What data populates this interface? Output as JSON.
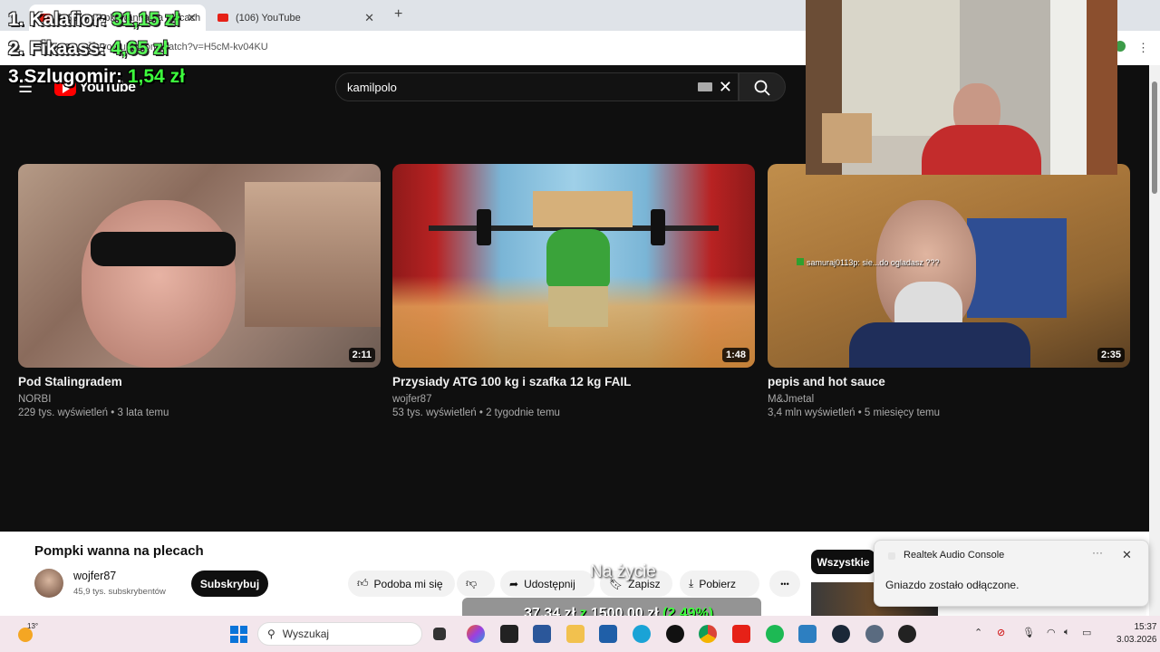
{
  "browser": {
    "tabs": [
      {
        "label": "(106) Pompki wanna na plecach",
        "active": true
      },
      {
        "label": "(106) YouTube",
        "active": false
      }
    ],
    "url": "youtube.com/watch?v=H5cM-kv04KU"
  },
  "youtube": {
    "search_query": "kamilpolo",
    "videos": [
      {
        "title": "Pod Stalingradem",
        "channel": "NORBI",
        "meta": "229 tys. wyświetleń • 3 lata temu",
        "duration": "2:11"
      },
      {
        "title": "Przysiady ATG 100 kg i szafka 12 kg FAIL",
        "channel": "wojfer87",
        "meta": "53 tys. wyświetleń • 2 tygodnie temu",
        "duration": "1:48"
      },
      {
        "title": "pepis and hot sauce",
        "channel": "M&Jmetal",
        "meta": "3,4 mln wyświetleń • 5 miesięcy temu",
        "duration": "2:35"
      }
    ],
    "chat_overlay": {
      "user": "samuraj0113p:",
      "message": "sie...do ogladasz ???"
    }
  },
  "watch": {
    "title": "Pompki wanna na plecach",
    "channel": "wojfer87",
    "subs": "45,9 tys. subskrybentów",
    "subscribe": "Subskrybuj",
    "like": "Podoba mi się",
    "share": "Udostępnij",
    "save": "Zapisz",
    "download": "Pobierz",
    "more": "•••",
    "all_chip": "Wszystkie"
  },
  "overlay": {
    "donors": [
      {
        "rank": "1. Kalafior:",
        "amount": "31,15 zł"
      },
      {
        "rank": "2. Fikaass:",
        "amount": "4,65 zł"
      },
      {
        "rank": "3.Szlugomir:",
        "amount": "1,54 zł"
      }
    ],
    "goal_label": "Na życie",
    "goal_current": "37,34 zł",
    "goal_sep": "z",
    "goal_target": "1500,00 zł",
    "goal_pct": "(2.49%)"
  },
  "toast": {
    "app": "Realtek Audio Console",
    "message": "Gniazdo zostało odłączone."
  },
  "taskbar": {
    "search_placeholder": "Wyszukaj",
    "temp": "13°",
    "time": "15:37",
    "date": "3.03.2026"
  },
  "colors": {
    "youtube_red": "#ff0000",
    "donation_green": "#3dff3d",
    "windows_blue": "#0a74d9"
  }
}
